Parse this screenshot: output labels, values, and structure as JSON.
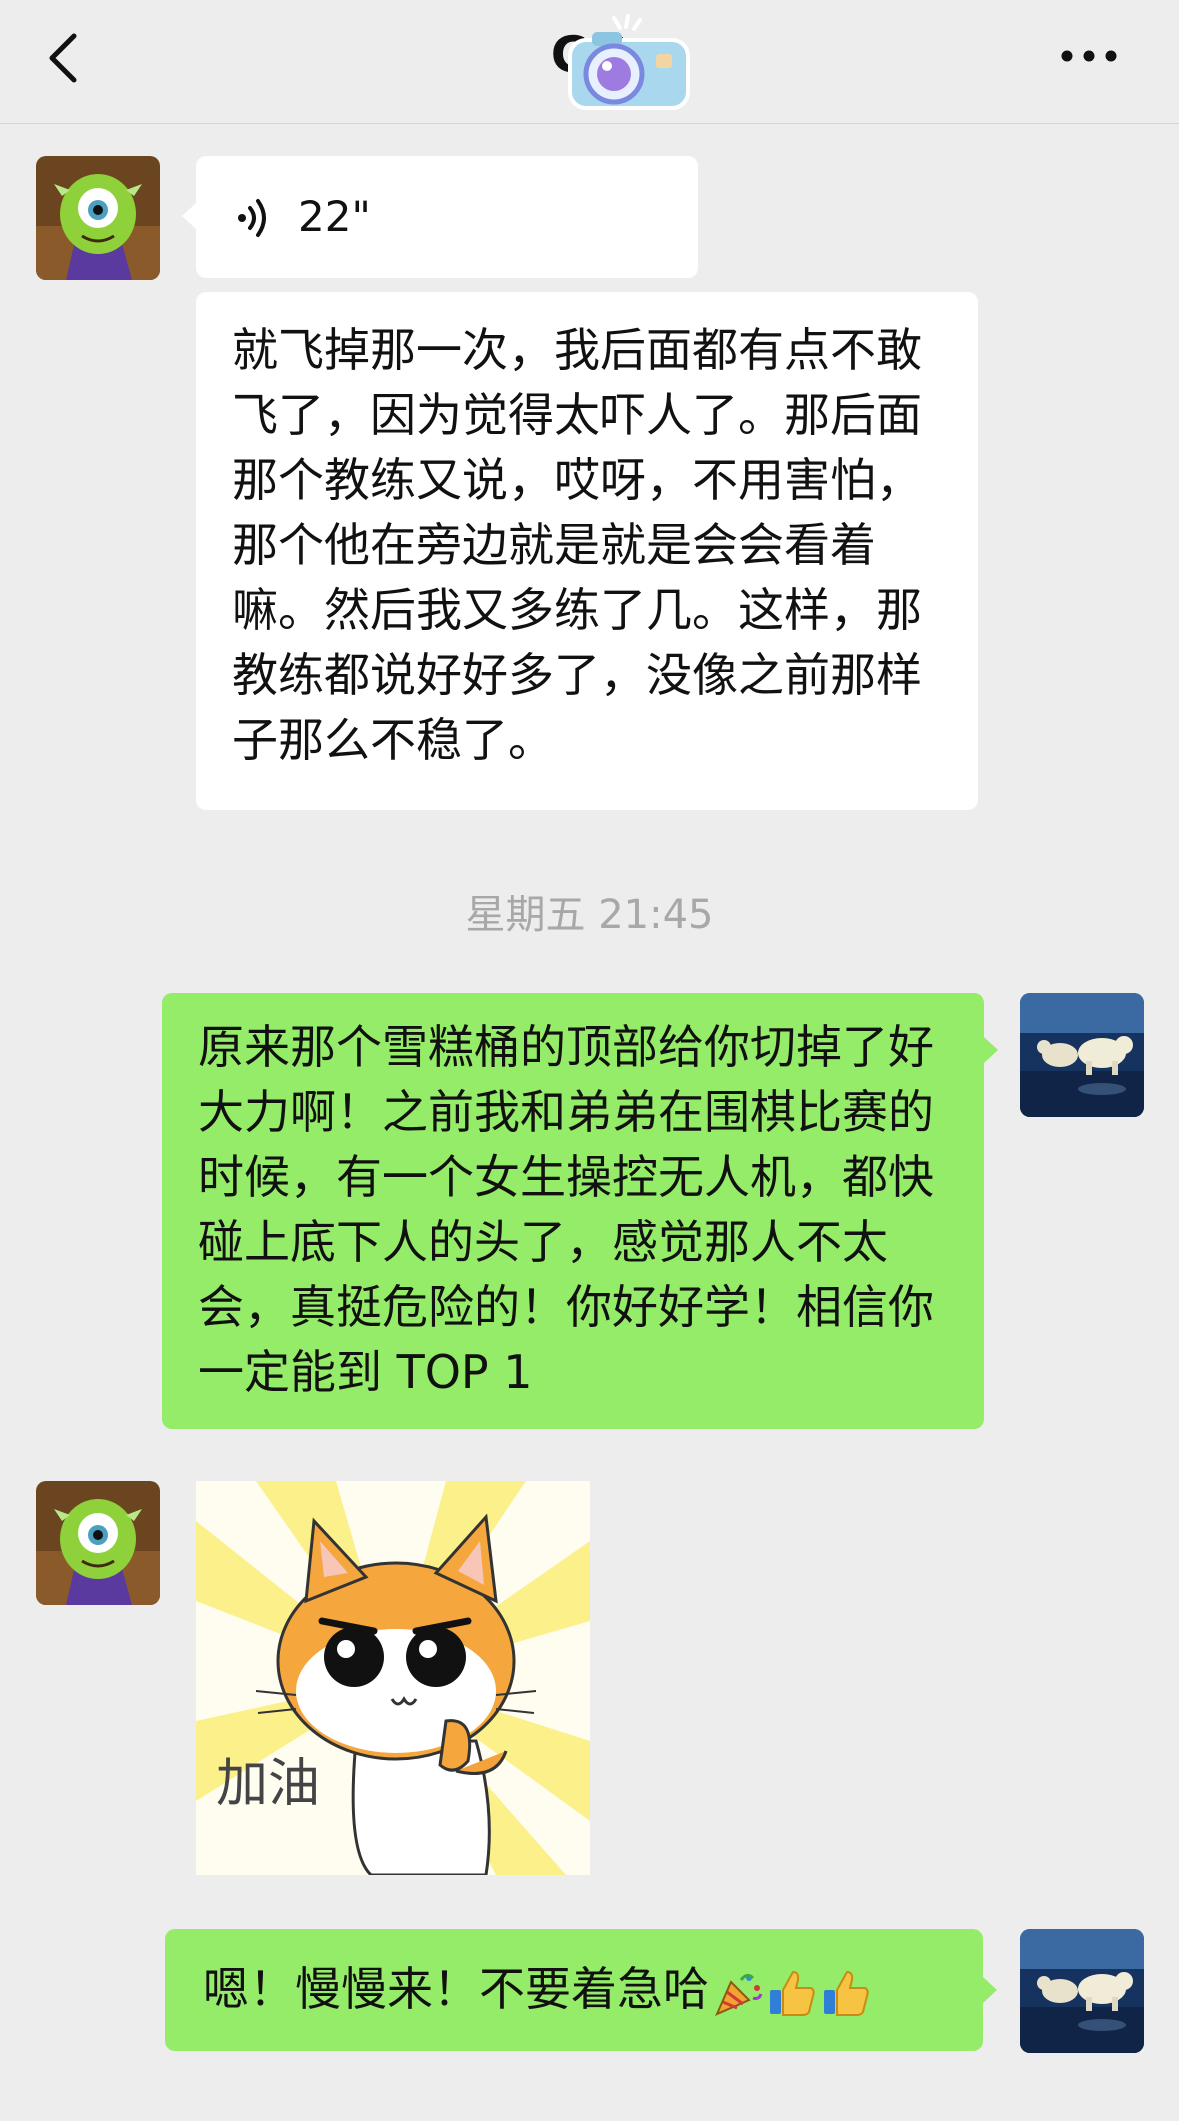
{
  "header": {
    "title": "CC",
    "back_icon": "chevron-left-icon",
    "more_icon": "more-dots-icon"
  },
  "messages": {
    "voice": {
      "duration": "22\""
    },
    "received_text": "就飞掉那一次，我后面都有点不敢飞了，因为觉得太吓人了。那后面那个教练又说，哎呀，不用害怕，那个他在旁边就是就是会会看着嘛。然后我又多练了几。这样，那教练都说好好多了，没像之前那样子那么不稳了。",
    "timestamp": "星期五 21:45",
    "sent_text": "原来那个雪糕桶的顶部给你切掉了好大力啊！之前我和弟弟在围棋比赛的时候，有一个女生操控无人机，都快碰上底下人的头了，感觉那人不太会，真挺危险的！你好好学！相信你一定能到 TOP 1",
    "sticker_text": "加油",
    "last_sent_text": "嗯！慢慢来！不要着急哈"
  },
  "colors": {
    "background": "#ededed",
    "received_bubble": "#ffffff",
    "sent_bubble": "#95ec69",
    "timestamp": "#a8a8a8"
  },
  "icons": [
    "chevron-left-icon",
    "camera-sticker-icon",
    "more-dots-icon",
    "voice-wave-icon",
    "party-popper-icon",
    "thumbs-up-icon"
  ]
}
